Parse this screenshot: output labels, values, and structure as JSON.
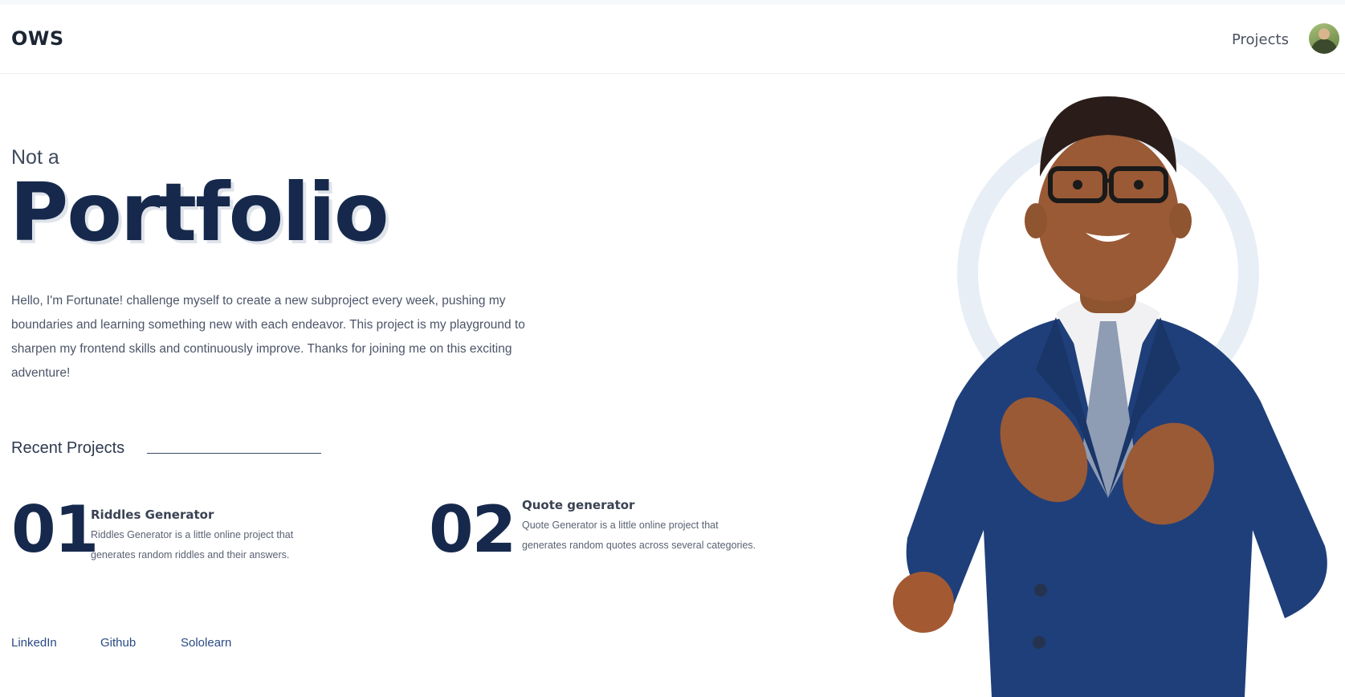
{
  "header": {
    "logo": "OWS",
    "nav": {
      "projects_label": "Projects"
    },
    "avatar_icon": "user-avatar"
  },
  "hero": {
    "pre_title": "Not a",
    "title": "Portfolio",
    "intro": "Hello, I'm Fortunate! challenge myself to create a new subproject every week, pushing my boundaries and learning something new with each endeavor. This project is my playground to sharpen my frontend skills and continuously improve. Thanks for joining me on this exciting adventure!"
  },
  "recent": {
    "label": "Recent Projects",
    "items": [
      {
        "number": "01",
        "title": "Riddles Generator",
        "description": "Riddles Generator is a little online project that generates random riddles and their answers."
      },
      {
        "number": "02",
        "title": "Quote generator",
        "description": "Quote Generator is a little online project that generates random quotes across several categories."
      }
    ]
  },
  "social": {
    "links": [
      "LinkedIn",
      "Github",
      "Sololearn"
    ]
  },
  "colors": {
    "primary": "#16294d",
    "link": "#294a85",
    "suit": "#1f3f7a",
    "skin": "#9a5a36"
  }
}
